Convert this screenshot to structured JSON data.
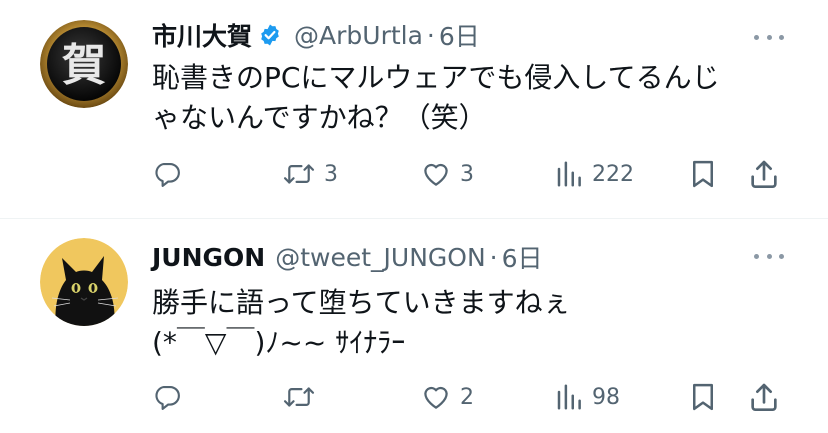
{
  "tweets": [
    {
      "display_name": "市川大賀",
      "verified": true,
      "handle": "@ArbUrtla",
      "separator": "·",
      "time": "6日",
      "text_lines": [
        "恥書きのPCにマルウェアでも侵入してるんじ",
        "ゃないんですかね？（笑）"
      ],
      "reply_count": "",
      "retweet_count": "3",
      "like_count": "3",
      "view_count": "222",
      "avatar_glyph": "賀"
    },
    {
      "display_name": "JUNGON",
      "verified": false,
      "handle": "@tweet_JUNGON",
      "separator": "·",
      "time": "6日",
      "text_lines": [
        "勝手に語って堕ちていきますねぇ",
        "(*￣▽￣)ﾉ~~ ｻｲﾅﾗｰ"
      ],
      "reply_count": "",
      "retweet_count": "",
      "like_count": "2",
      "view_count": "98"
    }
  ],
  "colors": {
    "text_primary": "#0f1419",
    "text_secondary": "#536471",
    "verified_blue": "#1d9bf0",
    "divider": "#eff3f4",
    "avatar_2_bg": "#f0c75e"
  },
  "icons": {
    "reply": "reply-bubble-icon",
    "retweet": "retweet-arrows-icon",
    "like": "heart-icon",
    "views": "bar-chart-icon",
    "bookmark": "bookmark-icon",
    "share": "share-upload-icon",
    "more": "more-dots-icon",
    "verified": "verified-badge-icon"
  }
}
